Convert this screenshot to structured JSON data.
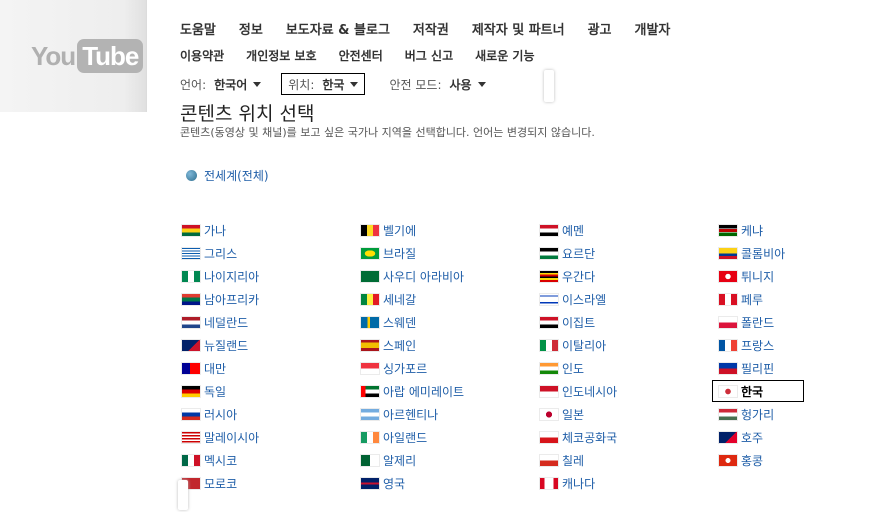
{
  "header": {
    "logo": {
      "you": "You",
      "tube": "Tube"
    },
    "nav_primary": [
      "도움말",
      "정보",
      "보도자료 & 블로그",
      "저작권",
      "제작자 및 파트너",
      "광고",
      "개발자"
    ],
    "nav_secondary": [
      "이용약관",
      "개인정보 보호",
      "안전센터",
      "버그 신고",
      "새로운 기능"
    ],
    "prefs": {
      "language": {
        "label": "언어:",
        "value": "한국어"
      },
      "location": {
        "label": "위치:",
        "value": "한국"
      },
      "safety": {
        "label": "안전 모드:",
        "value": "사용"
      }
    }
  },
  "main": {
    "title": "콘텐츠 위치 선택",
    "description": "콘텐츠(동영상 및 채널)를 보고 싶은 국가나 지역을 선택합니다. 언어는 변경되지 않습니다.",
    "worldwide": "전세계(전체)",
    "selected_country": "한국",
    "columns": [
      [
        {
          "name": "가나",
          "flag": "ghana"
        },
        {
          "name": "그리스",
          "flag": "greece"
        },
        {
          "name": "나이지리아",
          "flag": "nigeria"
        },
        {
          "name": "남아프리카",
          "flag": "south-africa"
        },
        {
          "name": "네덜란드",
          "flag": "netherlands"
        },
        {
          "name": "뉴질랜드",
          "flag": "new-zealand"
        },
        {
          "name": "대만",
          "flag": "taiwan"
        },
        {
          "name": "독일",
          "flag": "germany"
        },
        {
          "name": "러시아",
          "flag": "russia"
        },
        {
          "name": "말레이시아",
          "flag": "malaysia"
        },
        {
          "name": "멕시코",
          "flag": "mexico"
        },
        {
          "name": "모로코",
          "flag": "morocco"
        }
      ],
      [
        {
          "name": "벨기에",
          "flag": "belgium"
        },
        {
          "name": "브라질",
          "flag": "brazil"
        },
        {
          "name": "사우디 아라비아",
          "flag": "saudi-arabia"
        },
        {
          "name": "세네갈",
          "flag": "senegal"
        },
        {
          "name": "스웨덴",
          "flag": "sweden"
        },
        {
          "name": "스페인",
          "flag": "spain"
        },
        {
          "name": "싱가포르",
          "flag": "singapore"
        },
        {
          "name": "아랍 에미레이트",
          "flag": "uae"
        },
        {
          "name": "아르헨티나",
          "flag": "argentina"
        },
        {
          "name": "아일랜드",
          "flag": "ireland"
        },
        {
          "name": "알제리",
          "flag": "algeria"
        },
        {
          "name": "영국",
          "flag": "uk"
        }
      ],
      [
        {
          "name": "예멘",
          "flag": "yemen"
        },
        {
          "name": "요르단",
          "flag": "jordan"
        },
        {
          "name": "우간다",
          "flag": "uganda"
        },
        {
          "name": "이스라엘",
          "flag": "israel"
        },
        {
          "name": "이집트",
          "flag": "egypt"
        },
        {
          "name": "이탈리아",
          "flag": "italy"
        },
        {
          "name": "인도",
          "flag": "india"
        },
        {
          "name": "인도네시아",
          "flag": "indonesia"
        },
        {
          "name": "일본",
          "flag": "japan"
        },
        {
          "name": "체코공화국",
          "flag": "czech"
        },
        {
          "name": "칠레",
          "flag": "chile"
        },
        {
          "name": "캐나다",
          "flag": "canada"
        }
      ],
      [
        {
          "name": "케냐",
          "flag": "kenya"
        },
        {
          "name": "콜롬비아",
          "flag": "colombia"
        },
        {
          "name": "튀니지",
          "flag": "tunisia"
        },
        {
          "name": "페루",
          "flag": "peru"
        },
        {
          "name": "폴란드",
          "flag": "poland"
        },
        {
          "name": "프랑스",
          "flag": "france"
        },
        {
          "name": "필리핀",
          "flag": "philippines"
        },
        {
          "name": "한국",
          "flag": "korea"
        },
        {
          "name": "헝가리",
          "flag": "hungary"
        },
        {
          "name": "호주",
          "flag": "australia"
        },
        {
          "name": "홍콩",
          "flag": "hong-kong"
        }
      ]
    ]
  },
  "colors": {
    "link": "#1f5ea8",
    "text": "#333333",
    "selected_border": "#000000"
  }
}
